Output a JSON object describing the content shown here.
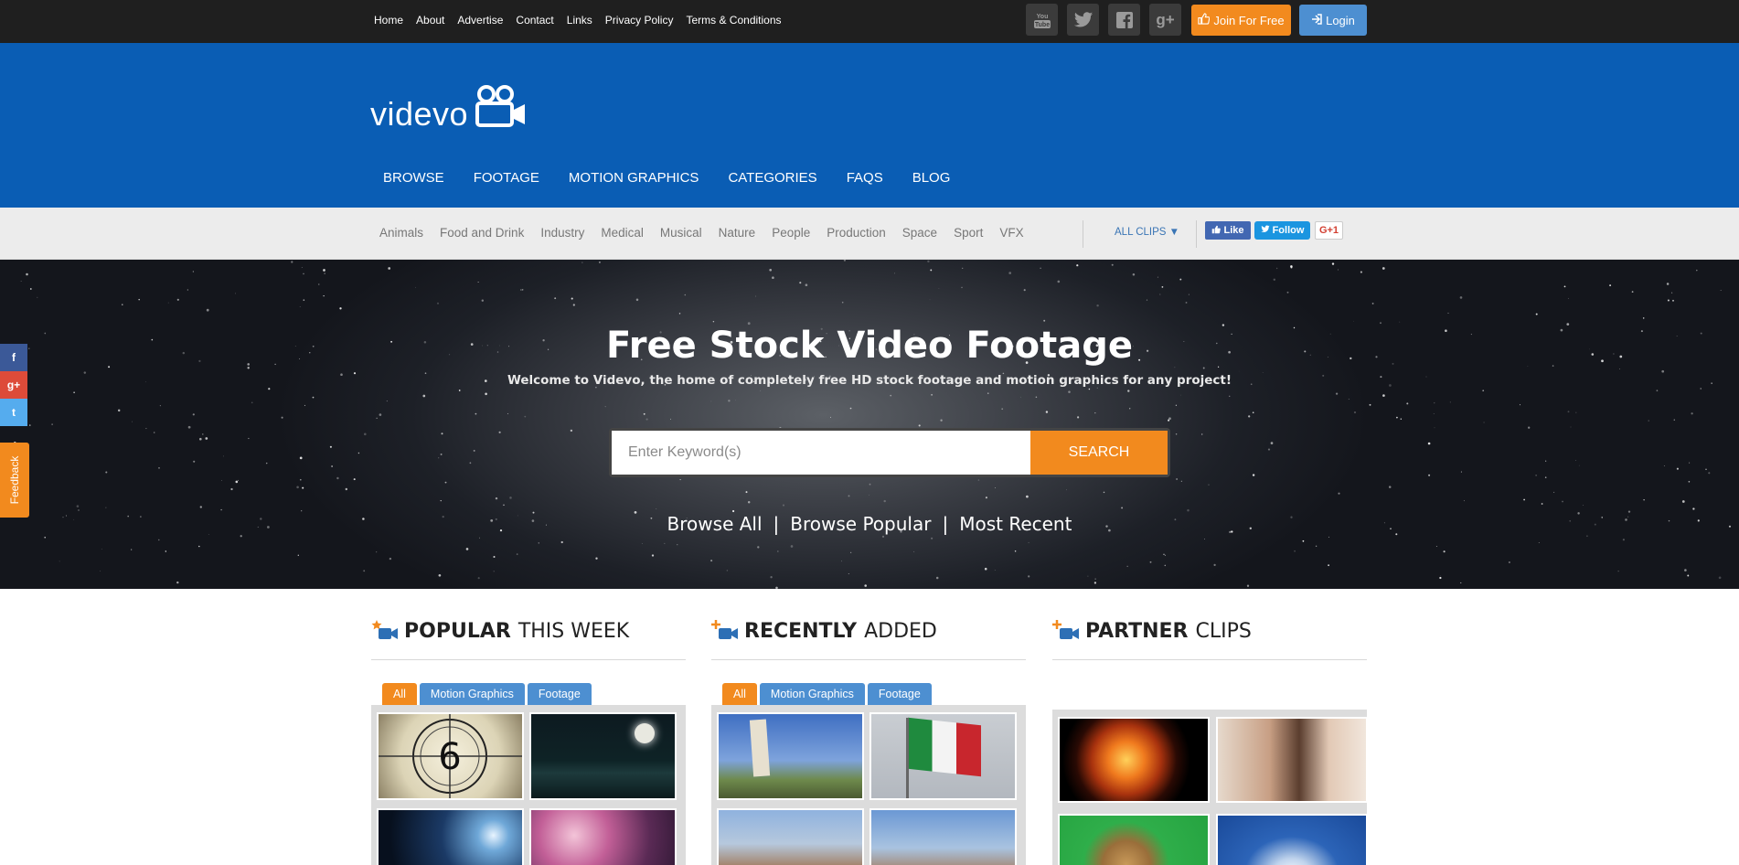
{
  "topbar": {
    "links": [
      "Home",
      "About",
      "Advertise",
      "Contact",
      "Links",
      "Privacy Policy",
      "Terms & Conditions"
    ],
    "social": [
      {
        "icon": "youtube-icon",
        "label": "You Tube"
      },
      {
        "icon": "twitter-icon",
        "label": ""
      },
      {
        "icon": "facebook-icon",
        "label": ""
      },
      {
        "icon": "google-plus-icon",
        "label": "g+"
      }
    ],
    "join_label": "Join For Free",
    "login_label": "Login"
  },
  "header": {
    "logo_text": "videvo",
    "nav": [
      "BROWSE",
      "FOOTAGE",
      "MOTION GRAPHICS",
      "CATEGORIES",
      "FAQS",
      "BLOG"
    ]
  },
  "categories": {
    "items": [
      "Animals",
      "Food and Drink",
      "Industry",
      "Medical",
      "Musical",
      "Nature",
      "People",
      "Production",
      "Space",
      "Sport",
      "VFX"
    ],
    "all_clips_label": "ALL CLIPS ▼",
    "fb_like": "Like",
    "tw_follow": "Follow",
    "gplus": "G+1"
  },
  "hero": {
    "title": "Free Stock Video Footage",
    "subtitle": "Welcome to Videvo, the home of completely free HD stock footage and motion graphics for any project!",
    "search_placeholder": "Enter Keyword(s)",
    "search_button": "SEARCH",
    "links": [
      "Browse All",
      "Browse Popular",
      "Most Recent"
    ]
  },
  "side_share": {
    "items": [
      {
        "icon": "facebook-icon",
        "glyph": "f",
        "color": "#3b5998"
      },
      {
        "icon": "google-plus-icon",
        "glyph": "g+",
        "color": "#dd4b39"
      },
      {
        "icon": "twitter-icon",
        "glyph": "t",
        "color": "#55acee"
      }
    ],
    "feedback_label": "Feedback"
  },
  "sections": [
    {
      "title_bold": "POPULAR",
      "title_rest": "THIS WEEK",
      "icon": "star-camera-icon",
      "tabs": [
        "All",
        "Motion Graphics",
        "Footage"
      ],
      "thumbs": [
        "film-countdown-6",
        "moon-over-sea",
        "earth-sunrise",
        "bokeh-lights"
      ]
    },
    {
      "title_bold": "RECENTLY",
      "title_rest": "ADDED",
      "icon": "plus-camera-icon",
      "tabs": [
        "All",
        "Motion Graphics",
        "Footage"
      ],
      "thumbs": [
        "leaning-tower-pisa",
        "italian-flag",
        "florence-cityscape",
        "florence-rooftops"
      ]
    },
    {
      "title_bold": "PARTNER",
      "title_rest": "CLIPS",
      "icon": "plus-camera-icon",
      "tabs": [],
      "thumbs": [
        "fire-explosion",
        "women-laughing-tea",
        "lion-green-screen",
        "blue-sky-clouds"
      ]
    }
  ],
  "colors": {
    "topbar": "#1f1f1f",
    "header": "#0a5db4",
    "accent_orange": "#f28a1e",
    "accent_blue": "#4d8fd1"
  }
}
